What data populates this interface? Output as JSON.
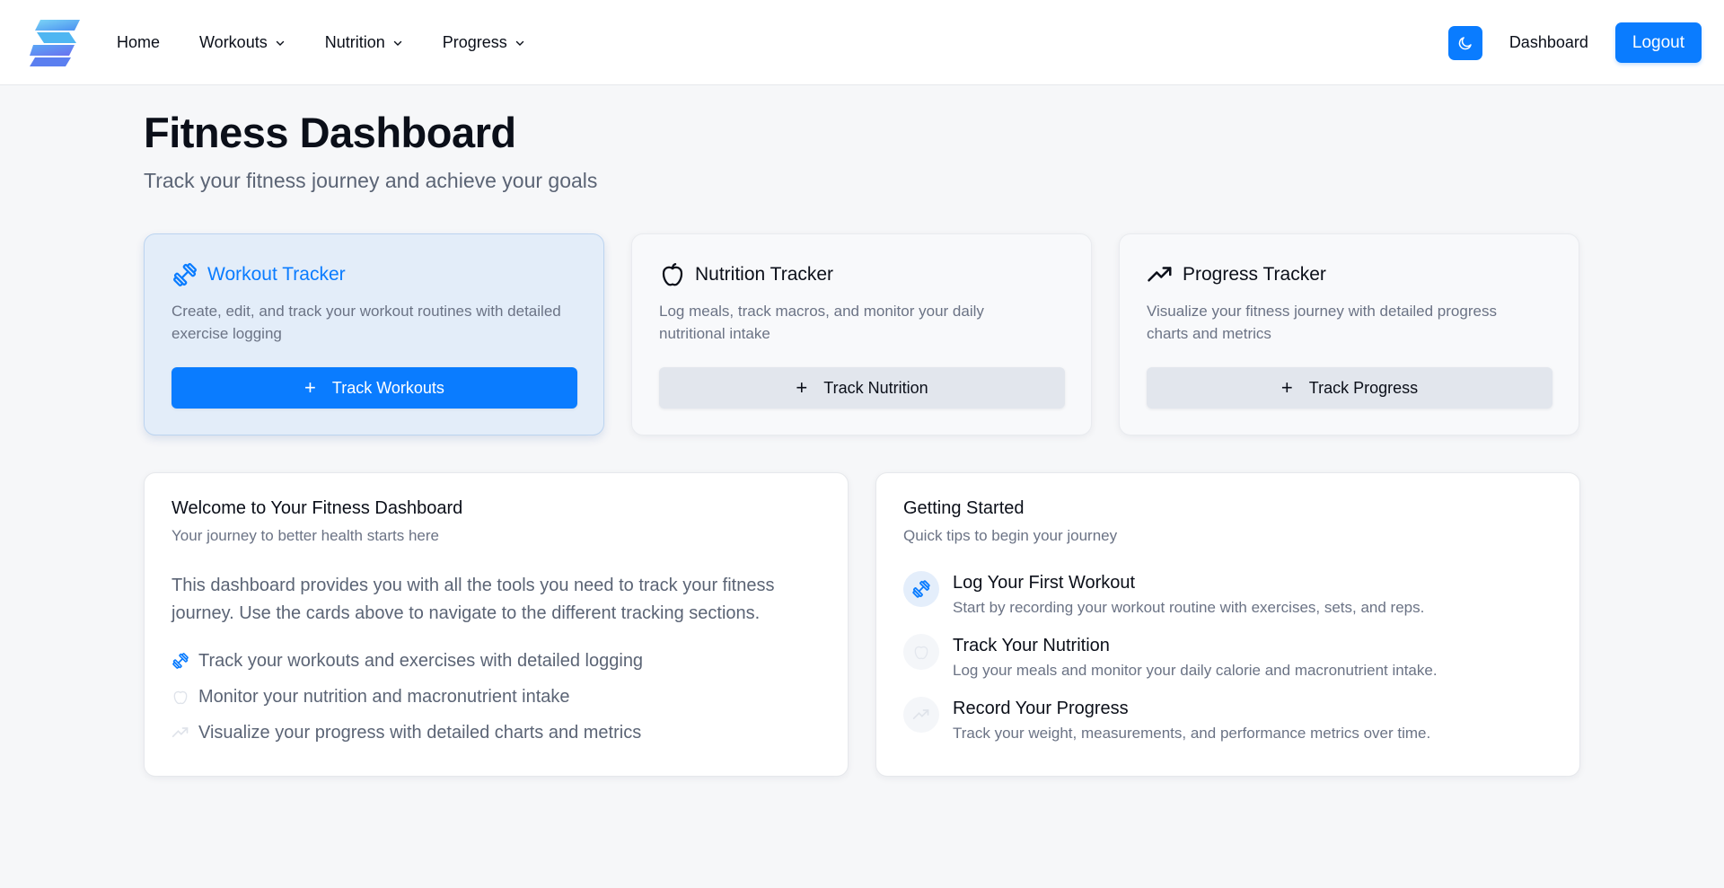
{
  "nav": {
    "links": [
      {
        "label": "Home"
      },
      {
        "label": "Workouts"
      },
      {
        "label": "Nutrition"
      },
      {
        "label": "Progress"
      }
    ],
    "dashboard_label": "Dashboard",
    "logout_label": "Logout"
  },
  "header": {
    "title": "Fitness Dashboard",
    "subtitle": "Track your fitness journey and achieve your goals"
  },
  "cards": [
    {
      "title": "Workout Tracker",
      "description": "Create, edit, and track your workout routines with detailed exercise logging",
      "button": "Track Workouts"
    },
    {
      "title": "Nutrition Tracker",
      "description": "Log meals, track macros, and monitor your daily nutritional intake",
      "button": "Track Nutrition"
    },
    {
      "title": "Progress Tracker",
      "description": "Visualize your fitness journey with detailed progress charts and metrics",
      "button": "Track Progress"
    }
  ],
  "welcome": {
    "title": "Welcome to Your Fitness Dashboard",
    "subtitle": "Your journey to better health starts here",
    "body": "This dashboard provides you with all the tools you need to track your fitness journey. Use the cards above to navigate to the different tracking sections.",
    "features": [
      "Track your workouts and exercises with detailed logging",
      "Monitor your nutrition and macronutrient intake",
      "Visualize your progress with detailed charts and metrics"
    ]
  },
  "getting_started": {
    "title": "Getting Started",
    "subtitle": "Quick tips to begin your journey",
    "tips": [
      {
        "title": "Log Your First Workout",
        "description": "Start by recording your workout routine with exercises, sets, and reps."
      },
      {
        "title": "Track Your Nutrition",
        "description": "Log your meals and monitor your daily calorie and macronutrient intake."
      },
      {
        "title": "Record Your Progress",
        "description": "Track your weight, measurements, and performance metrics over time."
      }
    ]
  },
  "colors": {
    "accent": "#0a7cff",
    "background": "#f6f7f9",
    "muted_text": "#6b7385"
  },
  "icons": [
    "logo",
    "chevron-down-icon",
    "moon-icon",
    "dumbbell-icon",
    "apple-icon",
    "trending-up-icon",
    "plus-icon"
  ]
}
